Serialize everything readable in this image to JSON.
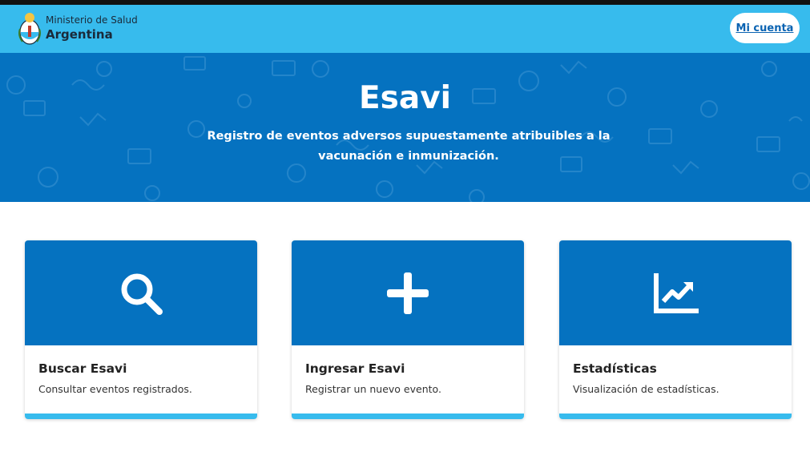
{
  "header": {
    "org_line1": "Ministerio de Salud",
    "org_line2": "Argentina",
    "account_button": "Mi cuenta"
  },
  "hero": {
    "title": "Esavi",
    "subtitle": "Registro de eventos adversos supuestamente atribuibles a la vacunación e inmunización."
  },
  "cards": [
    {
      "icon": "search-icon",
      "title": "Buscar Esavi",
      "description": "Consultar eventos registrados."
    },
    {
      "icon": "plus-icon",
      "title": "Ingresar Esavi",
      "description": "Registrar un nuevo evento."
    },
    {
      "icon": "chart-line-icon",
      "title": "Estadísticas",
      "description": "Visualización de estadísticas."
    }
  ],
  "colors": {
    "header_bg": "#37bbed",
    "hero_bg": "#0572c0",
    "card_top": "#0572c0",
    "card_accent": "#37bbed",
    "link": "#0a63b2"
  }
}
